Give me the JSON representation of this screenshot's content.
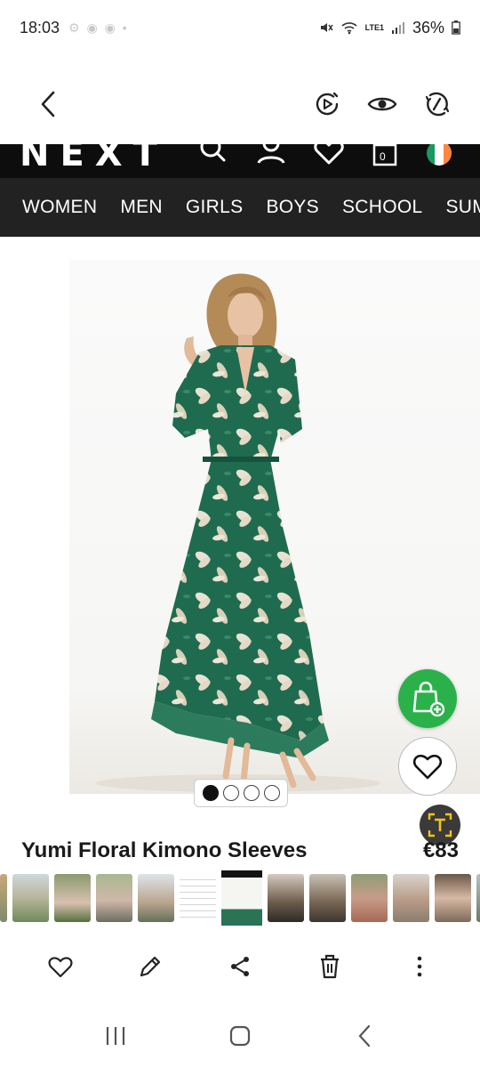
{
  "status_bar": {
    "time": "18:03",
    "battery": "36%",
    "network": "LTE1"
  },
  "site": {
    "logo": "NEXT",
    "bag_count": "0"
  },
  "categories": [
    "WOMEN",
    "MEN",
    "GIRLS",
    "BOYS",
    "SCHOOL",
    "SUMM"
  ],
  "product": {
    "title": "Yumi Floral Kimono Sleeves",
    "price": "€83"
  },
  "carousel": {
    "total": 4,
    "active_index": 1
  },
  "colors": {
    "accent_green": "#2bb14a",
    "header_black": "#0d0d0d",
    "nav_dark": "#222222",
    "dress_green": "#1f6b50",
    "flag_green": "#169b62",
    "flag_orange": "#ff883e"
  },
  "icons": [
    "back-arrow-icon",
    "video-play-icon",
    "eye-icon",
    "rotate-icon",
    "search-icon",
    "account-icon",
    "heart-icon",
    "bag-icon",
    "ireland-flag-icon",
    "add-to-bag-icon",
    "text-scan-icon",
    "share-icon",
    "edit-icon",
    "delete-icon",
    "more-icon"
  ]
}
